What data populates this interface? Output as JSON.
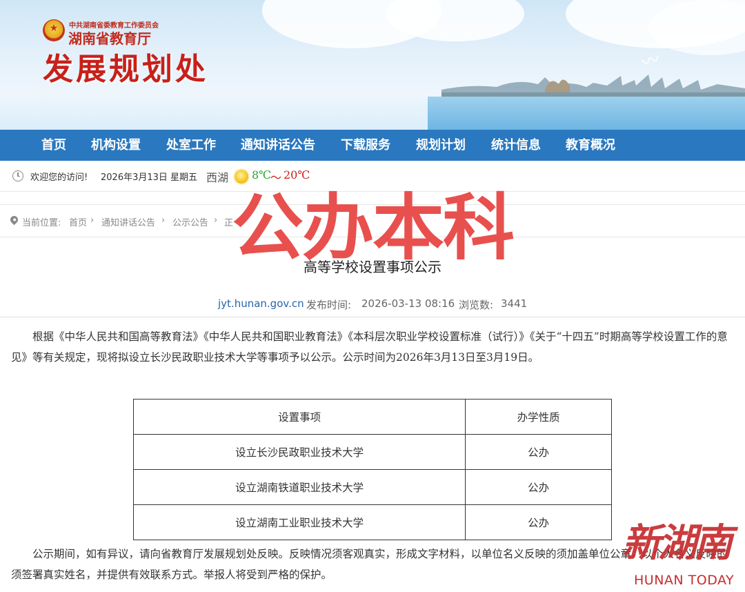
{
  "header": {
    "org_small": "中共湖南省委教育工作委员会",
    "org_name": "湖南省教育厅",
    "dept_title": "发展规划处",
    "emblem_icon": "national-emblem-icon"
  },
  "nav": {
    "items": [
      "首页",
      "机构设置",
      "处室工作",
      "通知讲话公告",
      "下载服务",
      "规划计划",
      "统计信息",
      "教育概况"
    ]
  },
  "infobar": {
    "welcome": "欢迎您的访问!",
    "date": "2026年3月13日 星期五",
    "city": "西湖",
    "weather_icon": "sunny-icon",
    "temp_low": "8℃",
    "temp_sep": "～",
    "temp_high": "20℃"
  },
  "breadcrumb": {
    "label": "当前位置:",
    "items": [
      "首页",
      "通知讲话公告",
      "公示公告",
      "正"
    ]
  },
  "watermark": "公办本科",
  "article": {
    "title": "高等学校设置事项公示",
    "source": "jyt.hunan.gov.cn",
    "publish_label": "发布时间:",
    "publish_time": "2026-03-13 08:16",
    "views_label": "浏览数:",
    "views": "3441",
    "para1": "根据《中华人民共和国高等教育法》《中华人民共和国职业教育法》《本科层次职业学校设置标准（试行）》《关于“十四五”时期高等学校设置工作的意见》等有关规定，现将拟设立长沙民政职业技术大学等事项予以公示。公示时间为2026年3月13日至3月19日。",
    "table": {
      "headers": [
        "设置事项",
        "办学性质"
      ],
      "rows": [
        [
          "设立长沙民政职业技术大学",
          "公办"
        ],
        [
          "设立湖南铁道职业技术大学",
          "公办"
        ],
        [
          "设立湖南工业职业技术大学",
          "公办"
        ]
      ]
    },
    "para2": "公示期间，如有异议，请向省教育厅发展规划处反映。反映情况须客观真实，形成文字材料，以单位名义反映的须加盖单位公章，以个人名义反映的须签署真实姓名，并提供有效联系方式。举报人将受到严格的保护。"
  },
  "news_logo": {
    "cn": "新湖南",
    "en": "HUNAN TODAY"
  }
}
